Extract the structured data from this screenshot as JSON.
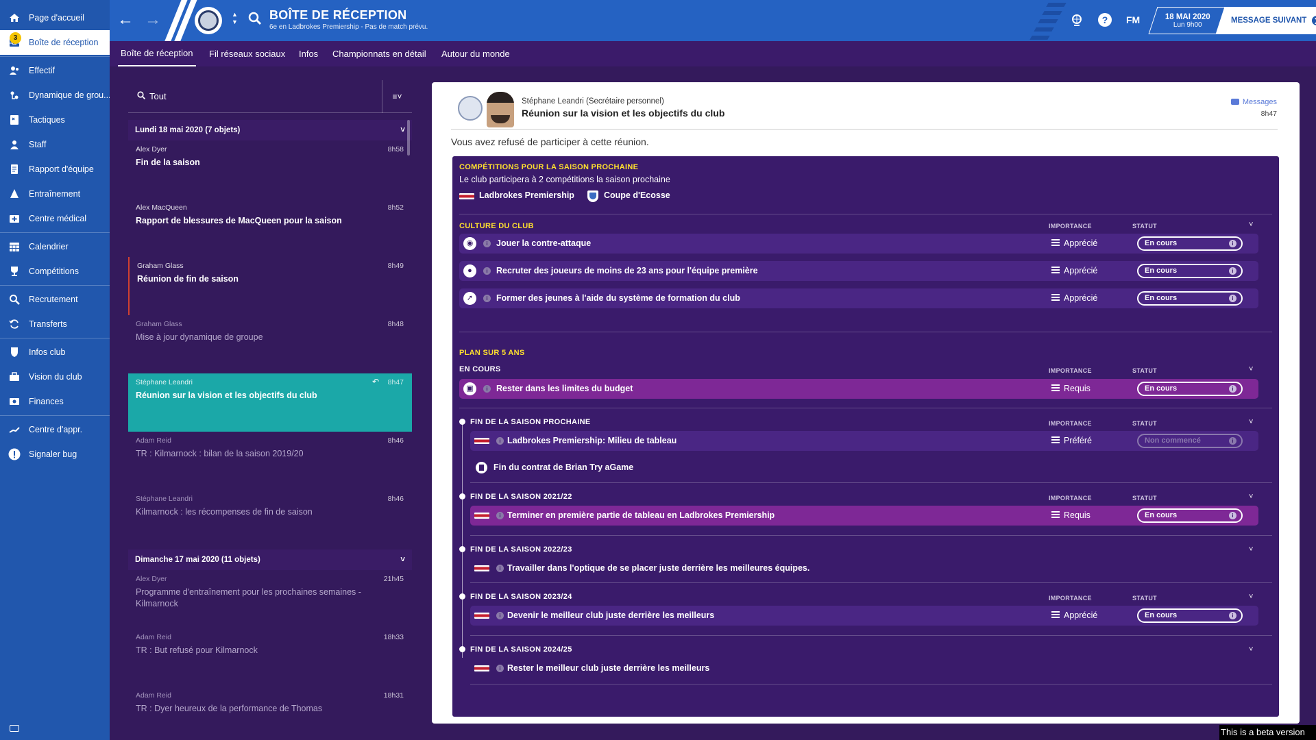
{
  "sidebar": {
    "items": [
      {
        "label": "Page d'accueil",
        "icon": "home-icon"
      },
      {
        "label": "Boîte de réception",
        "icon": "inbox-icon",
        "badge": "3",
        "active": true
      },
      {
        "label": "Effectif",
        "icon": "squad-icon"
      },
      {
        "label": "Dynamique de grou...",
        "icon": "dynamics-icon"
      },
      {
        "label": "Tactiques",
        "icon": "tactics-icon"
      },
      {
        "label": "Staff",
        "icon": "staff-icon"
      },
      {
        "label": "Rapport d'équipe",
        "icon": "report-icon"
      },
      {
        "label": "Entraînement",
        "icon": "training-icon"
      },
      {
        "label": "Centre médical",
        "icon": "medical-icon"
      },
      {
        "label": "Calendrier",
        "icon": "calendar-icon"
      },
      {
        "label": "Compétitions",
        "icon": "trophy-icon"
      },
      {
        "label": "Recrutement",
        "icon": "scouting-icon"
      },
      {
        "label": "Transferts",
        "icon": "transfer-icon"
      },
      {
        "label": "Infos club",
        "icon": "club-info-icon"
      },
      {
        "label": "Vision du club",
        "icon": "vision-icon"
      },
      {
        "label": "Finances",
        "icon": "finances-icon"
      },
      {
        "label": "Centre d'appr.",
        "icon": "academy-icon"
      },
      {
        "label": "Signaler bug",
        "icon": "bug-report-icon"
      }
    ]
  },
  "topbar": {
    "title": "BOÎTE DE RÉCEPTION",
    "subtitle": "6e en Ladbrokes Premiership - Pas de match prévu.",
    "date": "18 MAI 2020",
    "time": "Lun 9h00",
    "fm": "FM",
    "next": "MESSAGE SUIVANT"
  },
  "tabs": [
    "Boîte de réception",
    "Fil réseaux sociaux",
    "Infos",
    "Championnats en détail",
    "Autour du monde"
  ],
  "inbox": {
    "filter": "Tout",
    "group1": "Lundi 18 mai 2020 (7 objets)",
    "group2": "Dimanche 17 mai 2020 (11 objets)",
    "messages": [
      {
        "from": "Alex Dyer",
        "time": "8h58",
        "subject": "Fin de la saison"
      },
      {
        "from": "Alex MacQueen",
        "time": "8h52",
        "subject": "Rapport de blessures de MacQueen pour la saison"
      },
      {
        "from": "Graham Glass",
        "time": "8h49",
        "subject": "Réunion de fin de saison"
      },
      {
        "from": "Graham Glass",
        "time": "8h48",
        "subject": "Mise à jour dynamique de groupe"
      },
      {
        "from": "Stéphane Leandri",
        "time": "8h47",
        "subject": "Réunion sur la vision et les objectifs du club"
      },
      {
        "from": "Adam Reid",
        "time": "8h46",
        "subject": "TR : Kilmarnock : bilan de la saison 2019/20"
      },
      {
        "from": "Stéphane Leandri",
        "time": "8h46",
        "subject": "Kilmarnock : les récompenses de fin de saison"
      },
      {
        "from": "Alex Dyer",
        "time": "21h45",
        "subject": "Programme d'entraînement pour les prochaines semaines - Kilmarnock"
      },
      {
        "from": "Adam Reid",
        "time": "18h33",
        "subject": "TR : But refusé pour Kilmarnock"
      },
      {
        "from": "Adam Reid",
        "time": "18h31",
        "subject": "TR : Dyer heureux de la performance de Thomas"
      }
    ]
  },
  "detail": {
    "sender": "Stéphane Leandri  (Secrétaire personnel)",
    "subject": "Réunion sur la vision et les objectifs du club",
    "messages_link": "Messages",
    "time": "8h47",
    "refused": "Vous avez refusé de participer à cette réunion.",
    "comp_title": "COMPÉTITIONS POUR LA SAISON PROCHAINE",
    "comp_text": "Le club participera à 2 compétitions la saison prochaine",
    "comp1": "Ladbrokes Premiership",
    "comp2": "Coupe d'Ecosse",
    "culture_title": "CULTURE DU CLUB",
    "col_importance": "IMPORTANCE",
    "col_statut": "STATUT",
    "culture": [
      {
        "label": "Jouer la contre-attaque",
        "importance": "Apprécié",
        "status": "En cours"
      },
      {
        "label": "Recruter des joueurs de moins de 23 ans pour l'équipe première",
        "importance": "Apprécié",
        "status": "En cours"
      },
      {
        "label": "Former des jeunes à l'aide du système de formation du club",
        "importance": "Apprécié",
        "status": "En cours"
      }
    ],
    "plan_title": "PLAN SUR 5 ANS",
    "en_cours_title": "EN COURS",
    "budget": {
      "label": "Rester dans les limites du budget",
      "importance": "Requis",
      "status": "En cours"
    },
    "seasons": [
      {
        "title": "FIN DE LA SAISON PROCHAINE",
        "label": "Ladbrokes Premiership: Milieu de tableau",
        "importance": "Préféré",
        "status": "Non commencé",
        "extra": "Fin du contrat de Brian Try aGame"
      },
      {
        "title": "FIN DE LA SAISON 2021/22",
        "label": "Terminer en première partie de tableau en Ladbrokes Premiership",
        "importance": "Requis",
        "status": "En cours"
      },
      {
        "title": "FIN DE LA SAISON 2022/23",
        "label": "Travailler dans l'optique de se placer juste derrière les meilleures équipes."
      },
      {
        "title": "FIN DE LA SAISON 2023/24",
        "label": "Devenir le meilleur club juste derrière les meilleurs",
        "importance": "Apprécié",
        "status": "En cours"
      },
      {
        "title": "FIN DE LA SAISON 2024/25",
        "label": "Rester le meilleur club juste derrière les meilleurs"
      }
    ]
  },
  "beta": "This is a beta version"
}
